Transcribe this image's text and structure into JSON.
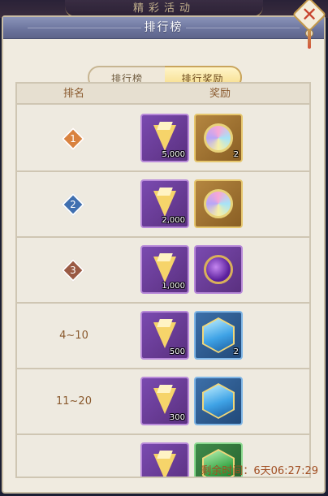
{
  "background": {
    "title": "精彩活动"
  },
  "header": {
    "title": "排行榜"
  },
  "tabs": [
    {
      "label": "排行榜",
      "active": false
    },
    {
      "label": "排行奖励",
      "active": true
    }
  ],
  "table": {
    "columns": [
      "排名",
      "奖励"
    ],
    "rows": [
      {
        "rank": "1",
        "rank_style": "gold-badge",
        "rewards": [
          {
            "icon": "crystal-icon",
            "frame": "purple",
            "count": "5,000"
          },
          {
            "icon": "prism-medal-icon",
            "frame": "gold",
            "count": "2"
          }
        ]
      },
      {
        "rank": "2",
        "rank_style": "blue-badge",
        "rewards": [
          {
            "icon": "crystal-icon",
            "frame": "purple",
            "count": "2,000"
          },
          {
            "icon": "prism-medal-icon",
            "frame": "gold",
            "count": ""
          }
        ]
      },
      {
        "rank": "3",
        "rank_style": "brown-badge",
        "rewards": [
          {
            "icon": "crystal-icon",
            "frame": "purple",
            "count": "1,000"
          },
          {
            "icon": "amethyst-medal-icon",
            "frame": "purple",
            "count": ""
          }
        ]
      },
      {
        "rank": "4~10",
        "rank_style": "text",
        "rewards": [
          {
            "icon": "crystal-icon",
            "frame": "purple",
            "count": "500"
          },
          {
            "icon": "blue-gem-icon",
            "frame": "blue",
            "count": "2"
          }
        ]
      },
      {
        "rank": "11~20",
        "rank_style": "text",
        "rewards": [
          {
            "icon": "crystal-icon",
            "frame": "purple",
            "count": "300"
          },
          {
            "icon": "blue-gem-icon",
            "frame": "blue",
            "count": ""
          }
        ]
      },
      {
        "rank": "",
        "rank_style": "text",
        "rewards": [
          {
            "icon": "crystal-icon",
            "frame": "purple",
            "count": ""
          },
          {
            "icon": "green-gem-icon",
            "frame": "green",
            "count": ""
          }
        ]
      }
    ]
  },
  "footer": {
    "remaining_label": "剩余时间：",
    "remaining_value": "6天06:27:29"
  },
  "colors": {
    "header_bg": "#6b739c",
    "panel_bg": "#f0ebe0",
    "accent_text": "#8a5a2e",
    "timer_text": "#a14e22",
    "rank1": "#d9823f",
    "rank2": "#3f6fb0",
    "rank3": "#9a5a44"
  }
}
